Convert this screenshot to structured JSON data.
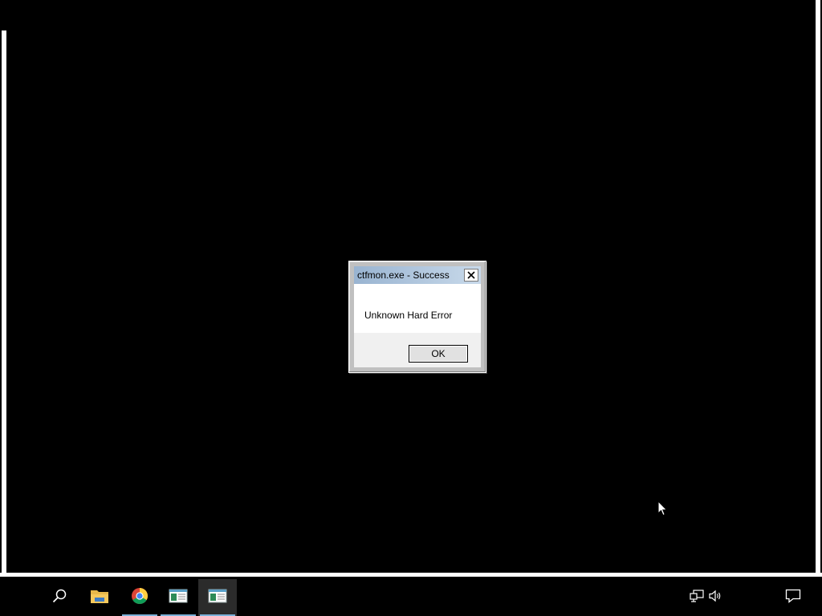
{
  "dialog": {
    "title": "ctfmon.exe - Success",
    "message": "Unknown Hard Error",
    "ok_label": "OK",
    "titlebar_color": "#99b4d1"
  },
  "taskbar": {
    "items": [
      {
        "name": "search-icon"
      },
      {
        "name": "file-explorer-icon"
      },
      {
        "name": "chrome-icon"
      },
      {
        "name": "window-app-icon"
      },
      {
        "name": "window-app-icon-selected"
      }
    ],
    "tray": [
      {
        "name": "network-icon"
      },
      {
        "name": "volume-icon"
      },
      {
        "name": "action-center-icon"
      }
    ],
    "accent_color": "#7ab0d8"
  }
}
